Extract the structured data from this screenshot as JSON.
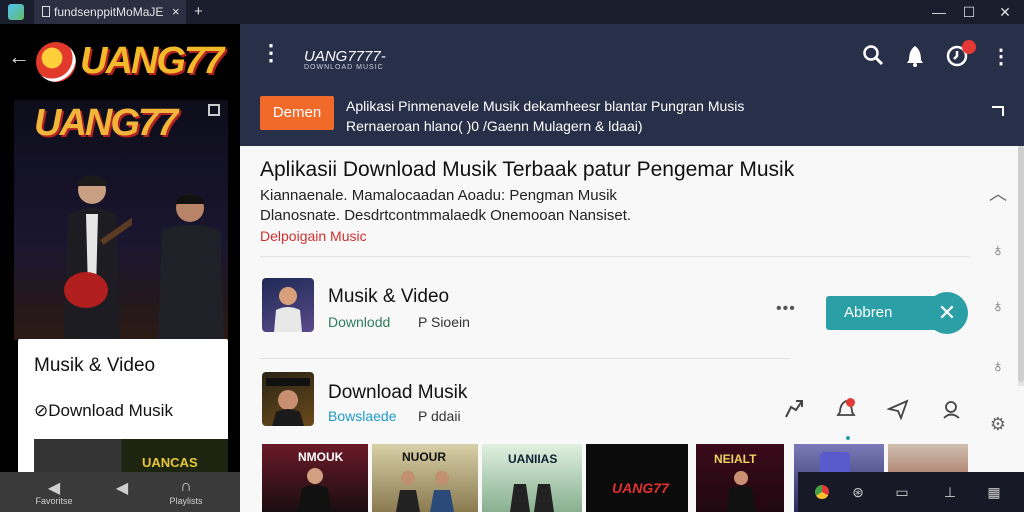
{
  "window": {
    "tab_title": "fundsenppitMoMaJE",
    "tab_close": "×",
    "new_tab": "+",
    "minimize": "—",
    "maximize": "☐",
    "close": "✕"
  },
  "left_panel": {
    "back_icon": "arrow-left-icon",
    "logo_text": "UANG77",
    "poster_title": "UANG77",
    "card": {
      "title": "Musik & Video",
      "download_label": "⊘Download Musik",
      "thumb_text": "UANCAS"
    },
    "bottom_bar": [
      {
        "icon": "speaker-icon",
        "label": "Favoritse"
      },
      {
        "icon": "speaker-icon",
        "label": ""
      },
      {
        "icon": "headphones-icon",
        "label": "Playlists"
      }
    ]
  },
  "header": {
    "brand": "UANG7777-",
    "brand_sub": "DOWNLOAD MUSIC",
    "icons": [
      "search-icon",
      "bell-icon",
      "notification-icon",
      "more-vert-icon"
    ]
  },
  "banner": {
    "button_label": "Demen",
    "text_line1": "Aplikasi Pinmenavele Musik dekamheesr blantar Pungran Musis",
    "text_line2": "Rernaeroan hlano( )0 /Gaenn Mulagern & ldaai)"
  },
  "main": {
    "heading": "Aplikasii Download Musik Terbaak patur Pengemar Musik",
    "desc_line1": "Kiannaenale. Mamalocaadan Aoadu: Pengman Musik",
    "desc_line2": "Dlanosnate. Desdrtcontmmalaedk Onemooan Nansiset.",
    "desc_line3": "Delpoigain Music",
    "items": [
      {
        "title": "Musik & Video",
        "sub1": "Downlodd",
        "sub2": "P Sioein",
        "sub1_color": "#2e7d5b",
        "dots": "•••",
        "action_label": "Abbren"
      },
      {
        "title": "Download Musik",
        "sub1": "Bowslaede",
        "sub2": "P ddaii",
        "sub1_color": "#1e9ac8"
      }
    ],
    "strip": [
      "NMOUK",
      "NUOUR",
      "UANIIAS",
      "UANG77",
      "NEIALT"
    ]
  },
  "colors": {
    "header_bg": "#283049",
    "accent_teal": "#2b9fa6",
    "button_orange": "#f26a2a",
    "badge_red": "#e53935"
  }
}
